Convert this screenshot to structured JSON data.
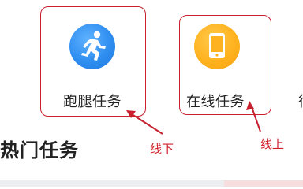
{
  "entries": [
    {
      "label": "跑腿任务",
      "icon": "running-man-icon",
      "color": "#2f8ef0"
    },
    {
      "label": "在线任务",
      "icon": "tablet-icon",
      "color": "#ffb21f"
    },
    {
      "label": "很"
    }
  ],
  "annotations": {
    "offline": "线下",
    "online": "线上",
    "color": "#c8202f"
  },
  "section_title": "热门任务"
}
